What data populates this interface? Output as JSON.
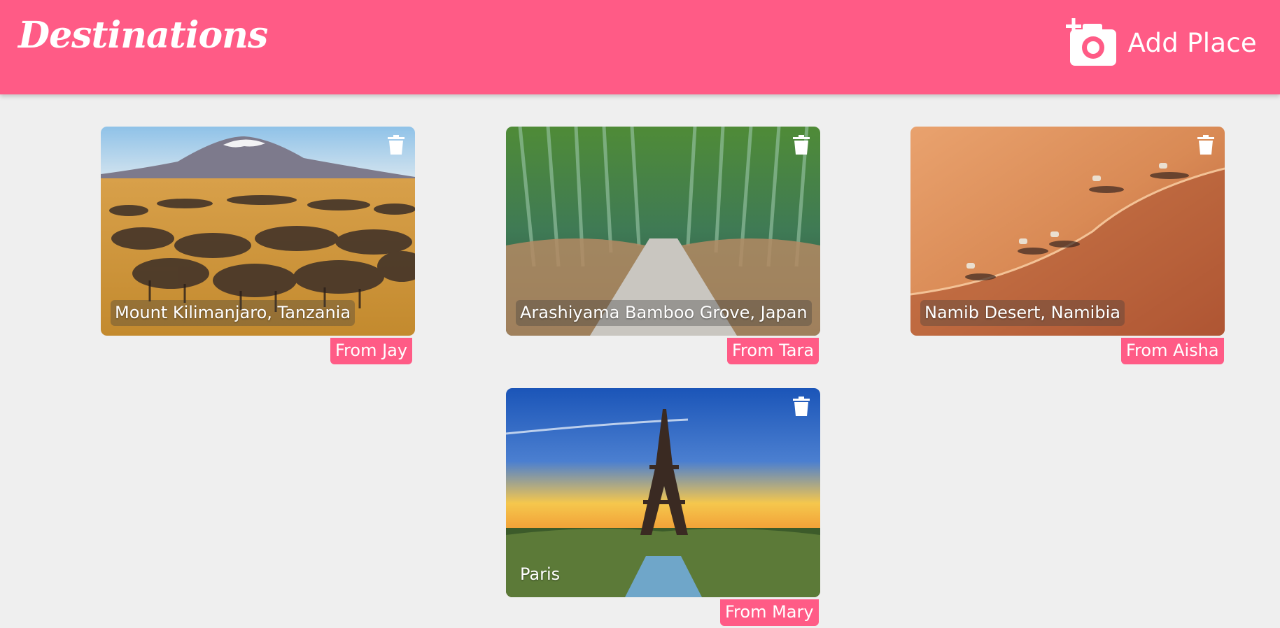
{
  "header": {
    "brand": "Destinations",
    "add_place_label": "Add Place"
  },
  "colors": {
    "accent": "#ff5b86",
    "background": "#efefef"
  },
  "icons": {
    "add_place": "add-camera-icon",
    "delete": "trash-icon"
  },
  "places": [
    {
      "name": "Mount Kilimanjaro, Tanzania",
      "from": "From Jay"
    },
    {
      "name": "Arashiyama Bamboo Grove, Japan",
      "from": "From Tara"
    },
    {
      "name": "Namib Desert, Namibia",
      "from": "From Aisha"
    },
    {
      "name": "Paris",
      "from": "From Mary"
    }
  ]
}
